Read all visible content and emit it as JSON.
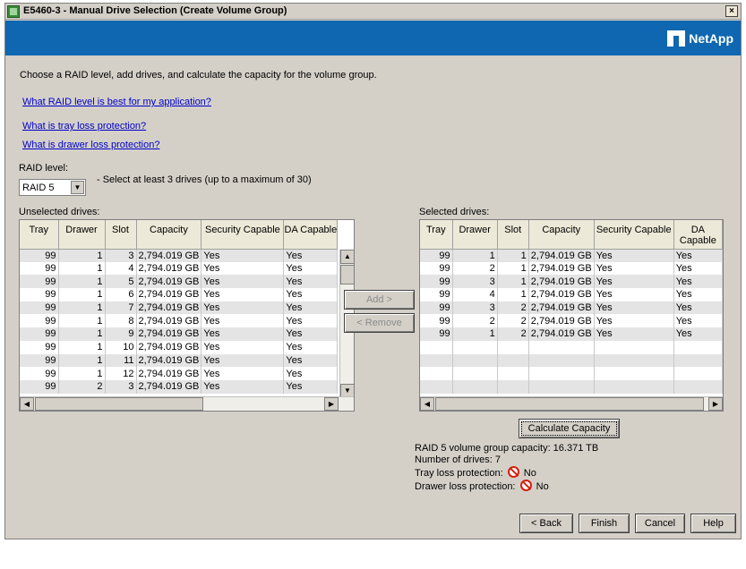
{
  "window": {
    "title": "E5460-3 - Manual Drive Selection (Create Volume Group)",
    "close": "×"
  },
  "brand": {
    "name": "NetApp"
  },
  "instruction": "Choose a RAID level, add drives, and calculate the capacity for the volume group.",
  "links": [
    "What RAID level is best for my application?",
    "What is tray loss protection?",
    "What is drawer loss protection?"
  ],
  "raid": {
    "label": "RAID level:",
    "value": "RAID 5",
    "hint": "- Select at least 3 drives (up to a maximum of 30)"
  },
  "columns": [
    "Tray",
    "Drawer",
    "Slot",
    "Capacity",
    "Security Capable",
    "DA Capable"
  ],
  "unselected": {
    "label": "Unselected drives:",
    "rows": [
      [
        "99",
        "1",
        "3",
        "2,794.019 GB",
        "Yes",
        "Yes"
      ],
      [
        "99",
        "1",
        "4",
        "2,794.019 GB",
        "Yes",
        "Yes"
      ],
      [
        "99",
        "1",
        "5",
        "2,794.019 GB",
        "Yes",
        "Yes"
      ],
      [
        "99",
        "1",
        "6",
        "2,794.019 GB",
        "Yes",
        "Yes"
      ],
      [
        "99",
        "1",
        "7",
        "2,794.019 GB",
        "Yes",
        "Yes"
      ],
      [
        "99",
        "1",
        "8",
        "2,794.019 GB",
        "Yes",
        "Yes"
      ],
      [
        "99",
        "1",
        "9",
        "2,794.019 GB",
        "Yes",
        "Yes"
      ],
      [
        "99",
        "1",
        "10",
        "2,794.019 GB",
        "Yes",
        "Yes"
      ],
      [
        "99",
        "1",
        "11",
        "2,794.019 GB",
        "Yes",
        "Yes"
      ],
      [
        "99",
        "1",
        "12",
        "2,794.019 GB",
        "Yes",
        "Yes"
      ],
      [
        "99",
        "2",
        "3",
        "2,794.019 GB",
        "Yes",
        "Yes"
      ]
    ]
  },
  "selected": {
    "label": "Selected drives:",
    "rows": [
      [
        "99",
        "1",
        "1",
        "2,794.019 GB",
        "Yes",
        "Yes"
      ],
      [
        "99",
        "2",
        "1",
        "2,794.019 GB",
        "Yes",
        "Yes"
      ],
      [
        "99",
        "3",
        "1",
        "2,794.019 GB",
        "Yes",
        "Yes"
      ],
      [
        "99",
        "4",
        "1",
        "2,794.019 GB",
        "Yes",
        "Yes"
      ],
      [
        "99",
        "3",
        "2",
        "2,794.019 GB",
        "Yes",
        "Yes"
      ],
      [
        "99",
        "2",
        "2",
        "2,794.019 GB",
        "Yes",
        "Yes"
      ],
      [
        "99",
        "1",
        "2",
        "2,794.019 GB",
        "Yes",
        "Yes"
      ]
    ]
  },
  "buttons": {
    "add": "Add >",
    "remove": "< Remove",
    "calculate": "Calculate Capacity",
    "back": "< Back",
    "finish": "Finish",
    "cancel": "Cancel",
    "help": "Help"
  },
  "results": {
    "capacity": "RAID 5 volume group capacity: 16.371 TB",
    "drives": "Number of drives: 7",
    "tray_label": "Tray loss protection:",
    "tray_value": "No",
    "drawer_label": "Drawer loss protection:",
    "drawer_value": "No"
  },
  "icons": {
    "no": "no-entry-icon",
    "status_color": "#d4200f"
  }
}
